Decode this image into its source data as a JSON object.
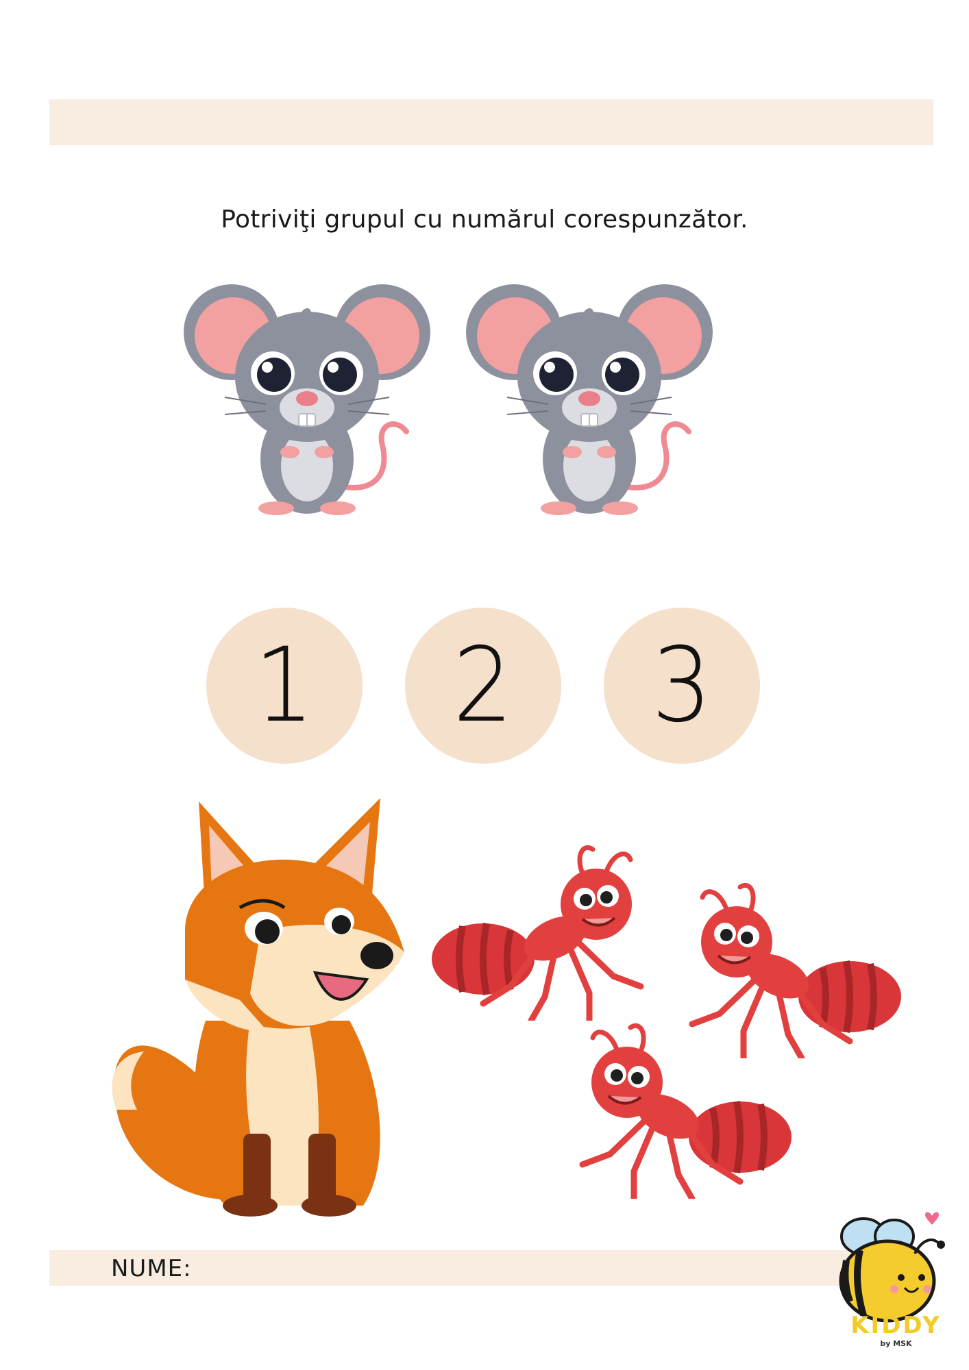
{
  "worksheet": {
    "instruction": "Potriviţi grupul cu numărul corespunzător.",
    "numbers": [
      "1",
      "2",
      "3"
    ],
    "name_label": "NUME:",
    "groups": [
      {
        "animal": "mouse-icon",
        "count": 2
      },
      {
        "animal": "fox-icon",
        "count": 1
      },
      {
        "animal": "ant-icon",
        "count": 3
      }
    ]
  },
  "branding": {
    "name": "KIDDY",
    "sub": "by MSK",
    "logo_icon": "bee-icon"
  },
  "colors": {
    "band": "#f8ede0",
    "circle": "#f5e0cb",
    "brand": "#f2cb2a"
  }
}
